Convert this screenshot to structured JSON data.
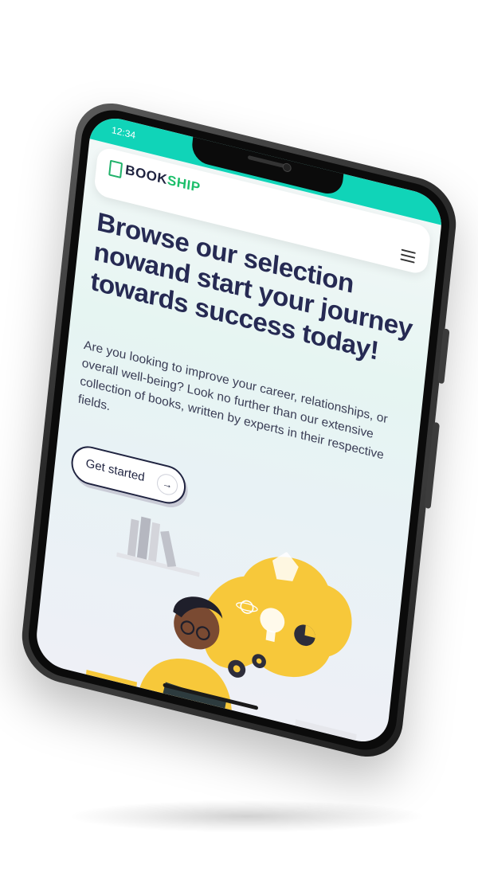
{
  "status_bar": {
    "time": "12:34 "
  },
  "navbar": {
    "logo_part_a": "BOOK",
    "logo_part_b": "SHIP",
    "menu_icon": "hamburger-menu-icon"
  },
  "hero": {
    "headline": "Browse our selection nowand start your journey towards success today!",
    "paragraph": "Are you looking to improve your career, relationships, or overall well-being? Look no further than our extensive collection of books, written by experts in their respective fields.",
    "cta_label": "Get started",
    "cta_icon": "arrow-right-icon"
  },
  "illustration": {
    "icon": "boy-reading-book-illustration"
  },
  "colors": {
    "accent_teal": "#10d4b8",
    "brand_green": "#1dbf6b",
    "heading_navy": "#262a53",
    "illustration_yellow": "#f7c83a"
  }
}
